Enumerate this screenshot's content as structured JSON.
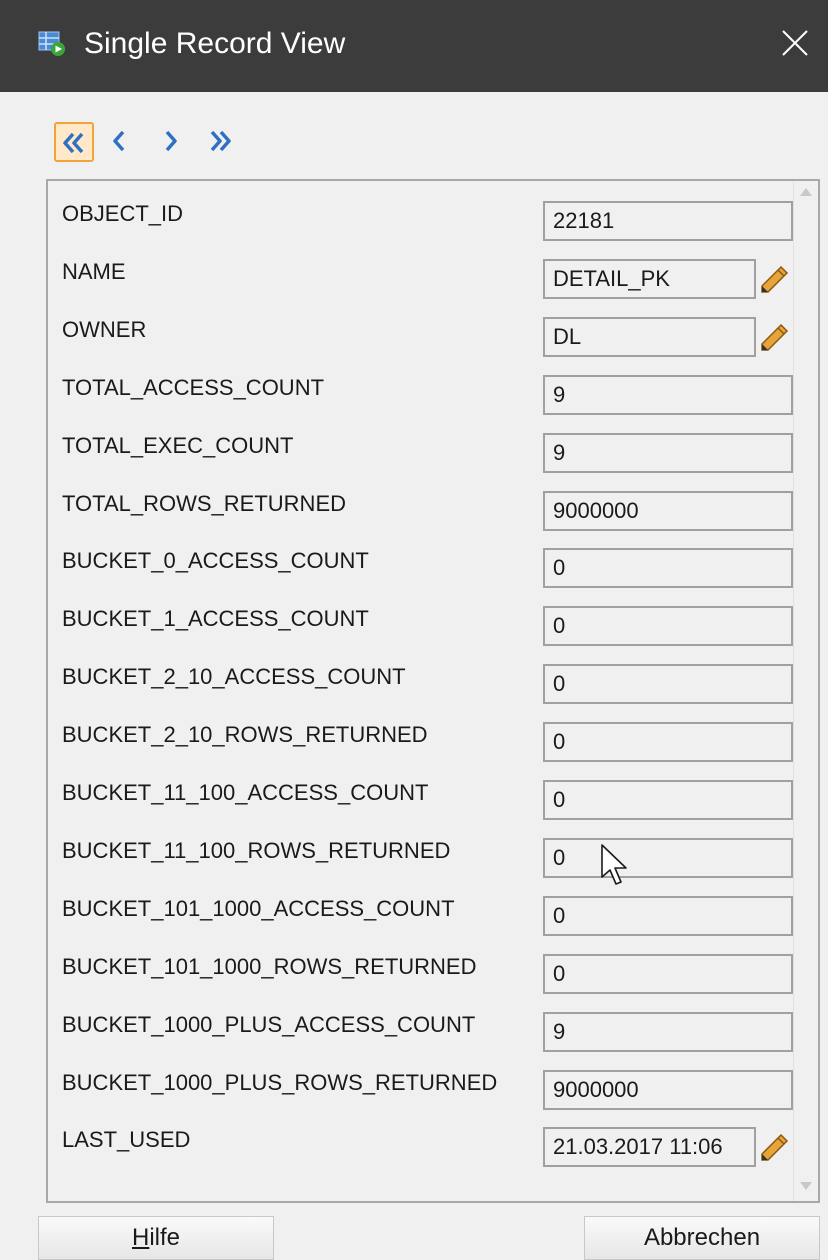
{
  "window": {
    "title": "Single Record View"
  },
  "nav": {
    "buttons": [
      "first-record",
      "previous-record",
      "next-record",
      "last-record"
    ]
  },
  "record": {
    "fields": [
      {
        "label": "OBJECT_ID",
        "value": "22181",
        "editable": false
      },
      {
        "label": "NAME",
        "value": "DETAIL_PK",
        "editable": true
      },
      {
        "label": "OWNER",
        "value": "DL",
        "editable": true
      },
      {
        "label": "TOTAL_ACCESS_COUNT",
        "value": "9",
        "editable": false
      },
      {
        "label": "TOTAL_EXEC_COUNT",
        "value": "9",
        "editable": false
      },
      {
        "label": "TOTAL_ROWS_RETURNED",
        "value": "9000000",
        "editable": false
      },
      {
        "label": "BUCKET_0_ACCESS_COUNT",
        "value": "0",
        "editable": false
      },
      {
        "label": "BUCKET_1_ACCESS_COUNT",
        "value": "0",
        "editable": false
      },
      {
        "label": "BUCKET_2_10_ACCESS_COUNT",
        "value": "0",
        "editable": false
      },
      {
        "label": "BUCKET_2_10_ROWS_RETURNED",
        "value": "0",
        "editable": false
      },
      {
        "label": "BUCKET_11_100_ACCESS_COUNT",
        "value": "0",
        "editable": false
      },
      {
        "label": "BUCKET_11_100_ROWS_RETURNED",
        "value": "0",
        "editable": false
      },
      {
        "label": "BUCKET_101_1000_ACCESS_COUNT",
        "value": "0",
        "editable": false
      },
      {
        "label": "BUCKET_101_1000_ROWS_RETURNED",
        "value": "0",
        "editable": false
      },
      {
        "label": "BUCKET_1000_PLUS_ACCESS_COUNT",
        "value": "9",
        "editable": false
      },
      {
        "label": "BUCKET_1000_PLUS_ROWS_RETURNED",
        "value": "9000000",
        "editable": false
      },
      {
        "label": "LAST_USED",
        "value": "21.03.2017 11:06",
        "editable": true
      }
    ]
  },
  "buttons": {
    "help_mnemonic": "H",
    "help_rest": "ilfe",
    "cancel": "Abbrechen"
  },
  "colors": {
    "titlebar": "#3c3c3c",
    "nav_arrow": "#2f6fc4",
    "nav_active_border": "#f2a33a",
    "edit_pencil": "#e8a33a"
  }
}
